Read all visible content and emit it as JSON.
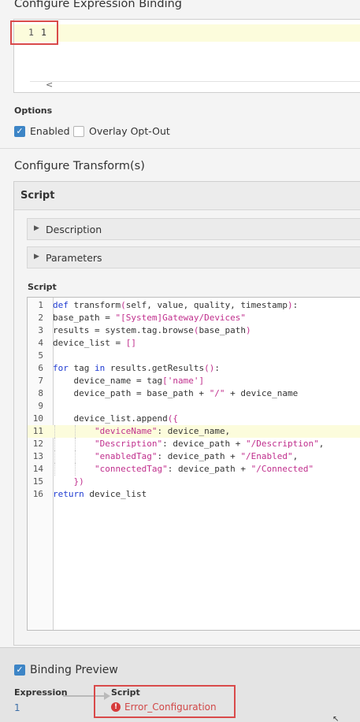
{
  "expression_binding": {
    "title": "Configure Expression Binding",
    "line_number": "1",
    "value": "1",
    "scroll_left_glyph": "<"
  },
  "options": {
    "label": "Options",
    "enabled_label": "Enabled",
    "enabled_checked": true,
    "overlay_label": "Overlay Opt-Out",
    "overlay_checked": false
  },
  "transforms": {
    "title": "Configure Transform(s)",
    "panel_title": "Script",
    "description_label": "Description",
    "parameters_label": "Parameters",
    "script_label": "Script"
  },
  "code_lines": [
    "def transform(self, value, quality, timestamp):",
    "base_path = \"[System]Gateway/Devices\"",
    "results = system.tag.browse(base_path)",
    "device_list = []",
    "",
    "for tag in results.getResults():",
    "    device_name = tag['name']",
    "    device_path = base_path + \"/\" + device_name",
    "",
    "    device_list.append({",
    "        \"deviceName\": device_name,",
    "        \"Description\": device_path + \"/Description\",",
    "        \"enabledTag\": device_path + \"/Enabled\",",
    "        \"connectedTag\": device_path + \"/Connected\"",
    "    })",
    "return device_list"
  ],
  "highlighted_line": 11,
  "binding_preview": {
    "label": "Binding Preview",
    "checked": true,
    "expression_label": "Expression",
    "expression_value": "1",
    "script_label": "Script",
    "error_text": "Error_Configuration"
  },
  "colors": {
    "accent": "#3d85c6",
    "keyword": "#1f3bd1",
    "string": "#c02f8d",
    "error": "#d14848",
    "highlight_box": "#d94a4a"
  }
}
